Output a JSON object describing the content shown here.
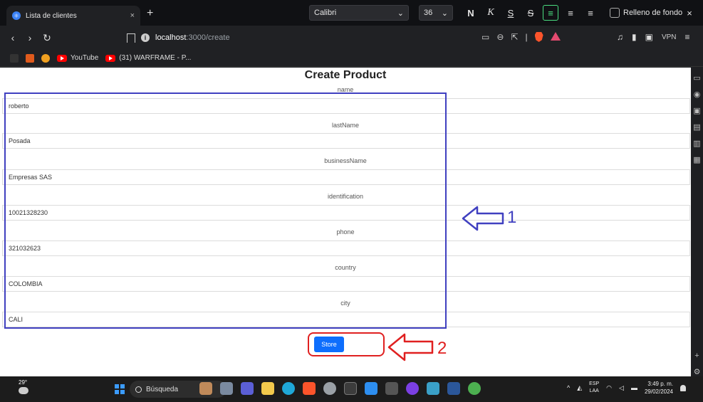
{
  "browser": {
    "tab": {
      "title": "Lista de clientes",
      "close": "×"
    },
    "new_tab": "+",
    "address": {
      "host": "localhost",
      "path": ":3000/create"
    },
    "vpn_label": "VPN",
    "bookmarks": [
      {
        "label": "YouTube"
      },
      {
        "label": "(31) WARFRAME - P..."
      }
    ]
  },
  "format_toolbar": {
    "font": "Calibri",
    "size": "36",
    "bold": "N",
    "italic": "K",
    "underline": "S",
    "strike": "S",
    "fill_label": "Relleno de fondo",
    "close": "×"
  },
  "page": {
    "title": "Create Product",
    "fields": [
      {
        "label": "name",
        "value": "roberto"
      },
      {
        "label": "lastName",
        "value": "Posada"
      },
      {
        "label": "businessName",
        "value": "Empresas SAS"
      },
      {
        "label": "identification",
        "value": "10021328230"
      },
      {
        "label": "phone",
        "value": "321032623"
      },
      {
        "label": "country",
        "value": "COLOMBIA"
      },
      {
        "label": "city",
        "value": "CALI"
      }
    ],
    "store_label": "Store"
  },
  "annotations": {
    "marker_1": "1",
    "marker_2": "2",
    "marker_1_color": "#4040c0",
    "marker_2_color": "#e02020"
  },
  "taskbar": {
    "weather": "29°",
    "search_placeholder": "Búsqueda",
    "lang_1": "ESP",
    "lang_2": "LAA",
    "time": "3:49 p. m.",
    "date": "29/02/2024"
  }
}
